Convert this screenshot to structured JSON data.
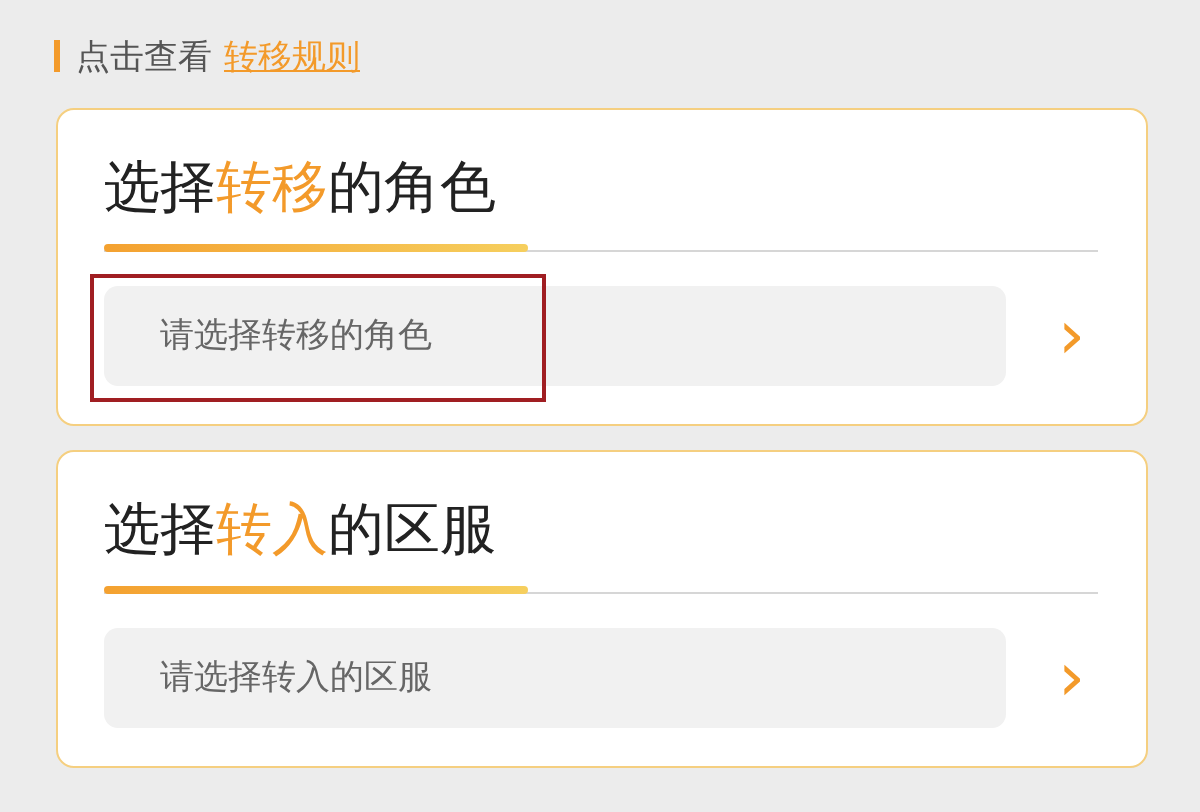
{
  "header": {
    "prefix": "点击查看",
    "link": "转移规则"
  },
  "cards": [
    {
      "title": [
        {
          "text": "选择",
          "accent": false
        },
        {
          "text": "转移",
          "accent": true
        },
        {
          "text": "的角色",
          "accent": false
        }
      ],
      "field": {
        "placeholder": "请选择转移的角色",
        "highlighted": true
      },
      "arrow": "›"
    },
    {
      "title": [
        {
          "text": "选择",
          "accent": false
        },
        {
          "text": "转入",
          "accent": true
        },
        {
          "text": "的区服",
          "accent": false
        }
      ],
      "field": {
        "placeholder": "请选择转入的区服",
        "highlighted": false
      },
      "arrow": "›"
    }
  ]
}
